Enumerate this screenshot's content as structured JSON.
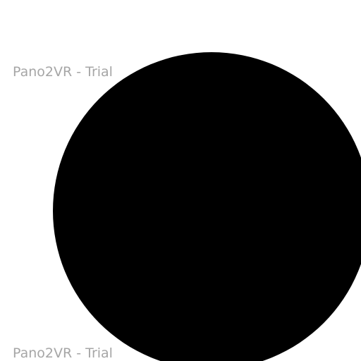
{
  "viewer": {
    "watermark_top": "Pano2VR - Trial",
    "watermark_bottom": "Pano2VR - Trial"
  },
  "colors": {
    "background": "#ffffff",
    "disc": "#000000",
    "watermark": "#a6a6a6"
  }
}
